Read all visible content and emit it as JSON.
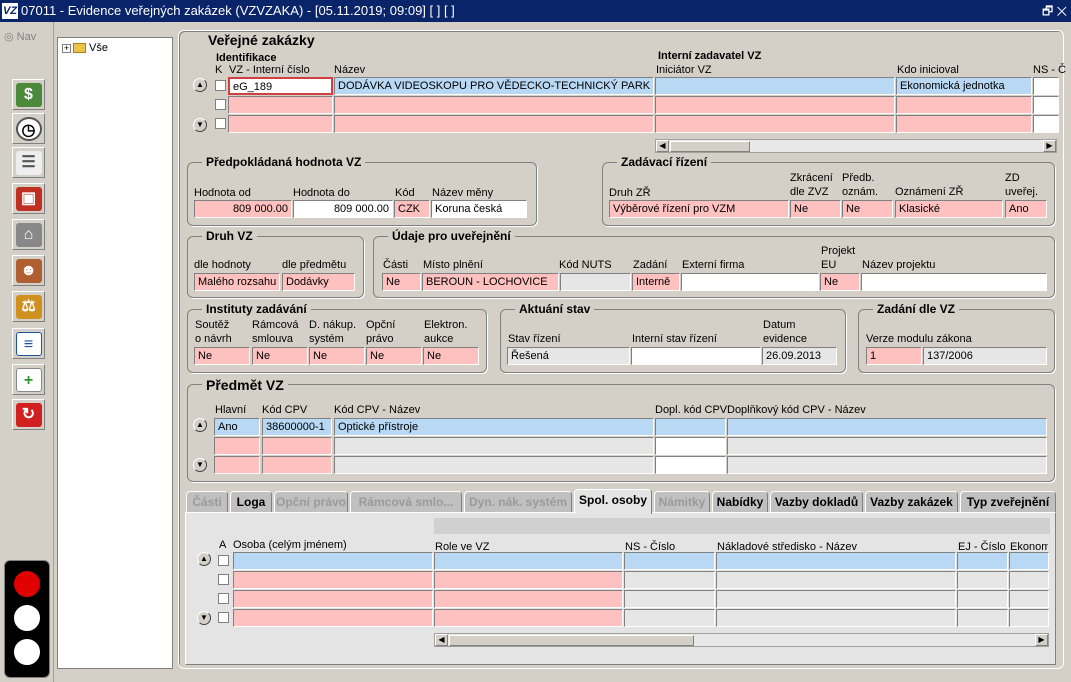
{
  "window": {
    "title": "07011 - Evidence veřejných zakázek (VZVZAKA) - [05.11.2019; 09:09]  [ ]  [ ]",
    "logo": "VZ",
    "controls": "🗗 ✕"
  },
  "nav": {
    "label": "Nav"
  },
  "tree": {
    "expander": "+",
    "root": "Vše"
  },
  "main": {
    "title": "Veřejné zakázky"
  },
  "vz": {
    "identifikace": "Identifikace",
    "interni_zadavatel": "Interní zadavatel VZ",
    "col_k": "K",
    "col_vz": "VZ - Interní číslo",
    "col_nazev": "Název",
    "col_iniciator": "Iniciátor VZ",
    "col_kdo": "Kdo inicioval",
    "col_ns": "NS - Č",
    "row1": {
      "vz": "eG_189",
      "nazev": "DODÁVKA VIDEOSKOPU PRO VĚDECKO-TECHNICKÝ PARK",
      "iniciator": "",
      "kdo": "Ekonomická jednotka"
    }
  },
  "hodnota": {
    "title": "Předpokládaná hodnota VZ",
    "lbl_od": "Hodnota od",
    "lbl_do": "Hodnota do",
    "lbl_kod": "Kód",
    "lbl_mena": "Název měny",
    "od": "809 000.00",
    "do": "809 000.00",
    "kod": "CZK",
    "mena": "Koruna česká"
  },
  "zadavaci": {
    "title": "Zadávací řízení",
    "lbl_druh": "Druh ZŘ",
    "lbl_zkr1": "Zkrácení",
    "lbl_zkr2": "dle ZVZ",
    "lbl_pred1": "Předb.",
    "lbl_pred2": "oznám.",
    "lbl_ozn": "Oznámení ZŘ",
    "lbl_zd1": "ZD",
    "lbl_zd2": "uveřej.",
    "druh": "Výběrové řízení pro VZM",
    "zkraceni": "Ne",
    "predb": "Ne",
    "oznameni": "Klasické",
    "zd": "Ano"
  },
  "druh": {
    "title": "Druh VZ",
    "lbl_hod": "dle hodnoty",
    "lbl_pred": "dle předmětu",
    "hodnoty": "Malého rozsahu",
    "predmetu": "Dodávky"
  },
  "udaje": {
    "title": "Údaje pro uveřejnění",
    "lbl_casti": "Části",
    "lbl_misto": "Místo plnění",
    "lbl_nuts": "Kód NUTS",
    "lbl_zadani": "Zadání",
    "lbl_firma": "Externí firma",
    "lbl_proj1": "Projekt",
    "lbl_proj2": "EU",
    "lbl_nazev": "Název projektu",
    "casti": "Ne",
    "misto": "BEROUN - LOCHOVICE",
    "nuts": "",
    "zadani": "Interně",
    "firma": "",
    "eu": "Ne",
    "nazev": ""
  },
  "instituty": {
    "title": "Instituty zadávání",
    "l1a": "Soutěž",
    "l1b": "o návrh",
    "l2a": "Rámcová",
    "l2b": "smlouva",
    "l3a": "D. nákup.",
    "l3b": "systém",
    "l4a": "Opční",
    "l4b": "právo",
    "l5a": "Elektron.",
    "l5b": "aukce",
    "v1": "Ne",
    "v2": "Ne",
    "v3": "Ne",
    "v4": "Ne",
    "v5": "Ne"
  },
  "aktualni": {
    "title": "Aktuání stav",
    "lbl_stav": "Stav řízení",
    "lbl_int": "Interní stav řízení",
    "lbl_dat1": "Datum",
    "lbl_dat2": "evidence",
    "stav": "Řešená",
    "interni": "",
    "datum": "26.09.2013"
  },
  "zadani_zvz": {
    "title": "Zadání dle VZ",
    "lbl": "Verze modulu zákona",
    "v1": "1",
    "v2": "137/2006"
  },
  "predmet": {
    "title": "Předmět VZ",
    "lbl_hlavni": "Hlavní",
    "lbl_kod": "Kód CPV",
    "lbl_nazev": "Kód CPV - Název",
    "lbl_dopl": "Dopl. kód CPV",
    "lbl_dopln": "Doplňkový kód CPV - Název",
    "hlavni": "Ano",
    "kod": "38600000-1",
    "nazev": "Optické přístroje"
  },
  "tabs": [
    "Části",
    "Loga",
    "Opční právo",
    "Rámcová smlo...",
    "Dyn. nák. systém",
    "Spol. osoby",
    "Námitky",
    "Nabídky",
    "Vazby dokladů",
    "Vazby zakázek",
    "Typ zveřejnění"
  ],
  "osoby": {
    "col_a": "A",
    "col_osoba": "Osoba (celým jménem)",
    "col_role": "Role ve VZ",
    "col_ns": "NS - Číslo",
    "col_nakl": "Nákladové středisko - Název",
    "col_ej": "EJ - Číslo",
    "col_eko": "Ekonomi"
  },
  "colors": {
    "pink": "#ffc0c0",
    "blue": "#b8d8f4",
    "title": "#0a246a"
  }
}
